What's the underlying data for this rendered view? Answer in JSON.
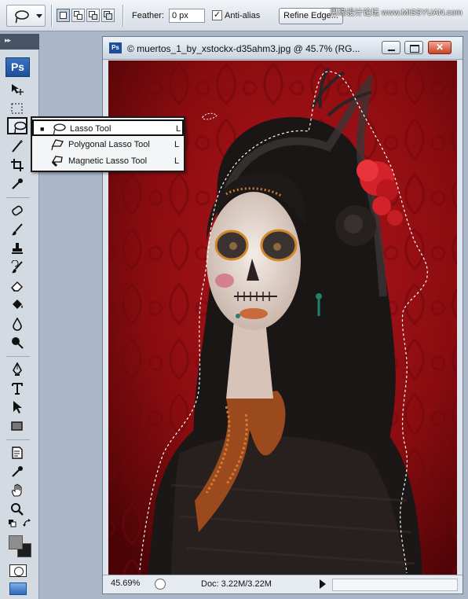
{
  "options_bar": {
    "feather_label": "Feather:",
    "feather_value": "0 px",
    "antialias_checked": "✓",
    "antialias_label": "Anti-alias",
    "refine_edge_label": "Refine Edge..."
  },
  "watermark": "思缘设计论坛 www.MISSYUAN.com",
  "toolbox": {
    "grip": "▸▸",
    "logo": "Ps",
    "foreground_color": "#8e8e8e",
    "background_color": "#1d1d1d"
  },
  "document": {
    "icon": "Ps",
    "title": "© muertos_1_by_xstockx-d35ahm3.jpg @ 45.7% (RG...",
    "zoom": "45.69%",
    "doc_size": "Doc: 3.22M/3.22M",
    "close_label": "✕"
  },
  "flyout": {
    "items": [
      {
        "bullet": "■",
        "label": "Lasso Tool",
        "shortcut": "L",
        "icon": "lasso-icon"
      },
      {
        "bullet": "",
        "label": "Polygonal Lasso Tool",
        "shortcut": "L",
        "icon": "polygonal-lasso-icon"
      },
      {
        "bullet": "",
        "label": "Magnetic Lasso Tool",
        "shortcut": "L",
        "icon": "magnetic-lasso-icon"
      }
    ]
  },
  "colors": {
    "accent": "#1d4f99",
    "canvas_red": "#7a0a0c",
    "selection_marquee": "#ffffff"
  }
}
